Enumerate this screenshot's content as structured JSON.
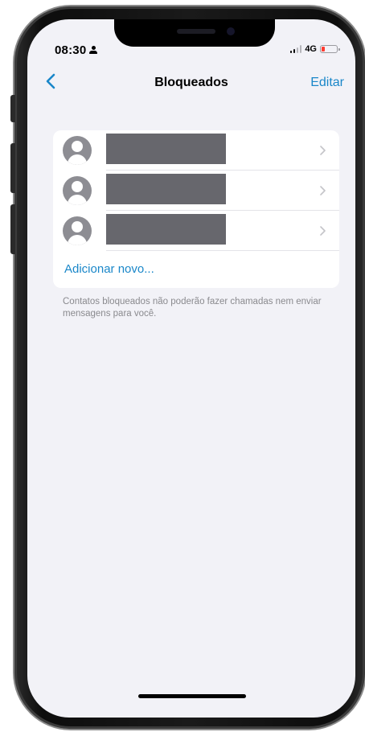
{
  "status_bar": {
    "time": "08:30",
    "network": "4G",
    "icons": [
      "person-icon",
      "signal-icon",
      "battery-icon"
    ],
    "battery_color": "#ff3b30"
  },
  "nav": {
    "back_icon": "chevron-left-icon",
    "title": "Bloqueados",
    "edit_label": "Editar"
  },
  "blocked_list": {
    "contacts": [
      {
        "avatar_icon": "person-avatar-icon",
        "name_redacted": true
      },
      {
        "avatar_icon": "person-avatar-icon",
        "name_redacted": true
      },
      {
        "avatar_icon": "person-avatar-icon",
        "name_redacted": true
      }
    ],
    "add_label": "Adicionar novo..."
  },
  "footnote": "Contatos bloqueados não poderão fazer chamadas nem enviar mensagens para você.",
  "colors": {
    "accent": "#1a87c9",
    "background": "#f2f2f7",
    "redaction": "#67676d"
  }
}
